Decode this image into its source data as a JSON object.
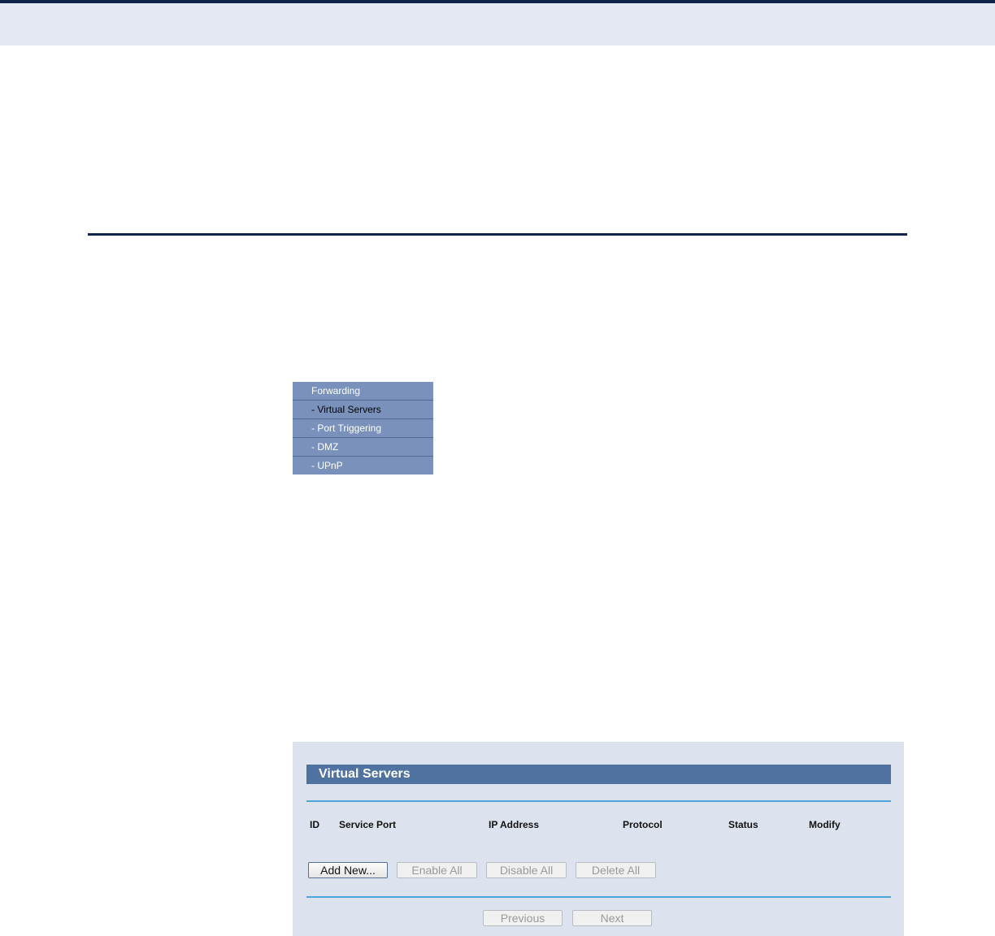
{
  "menu": {
    "items": [
      {
        "label": "Forwarding"
      },
      {
        "label": "- Virtual Servers"
      },
      {
        "label": "- Port Triggering"
      },
      {
        "label": "- DMZ"
      },
      {
        "label": "- UPnP"
      }
    ]
  },
  "panel": {
    "title": "Virtual Servers",
    "columns": [
      "ID",
      "Service Port",
      "IP Address",
      "Protocol",
      "Status",
      "Modify"
    ],
    "buttons": {
      "add_new": "Add New...",
      "enable_all": "Enable All",
      "disable_all": "Disable All",
      "delete_all": "Delete All",
      "previous": "Previous",
      "next": "Next"
    }
  }
}
